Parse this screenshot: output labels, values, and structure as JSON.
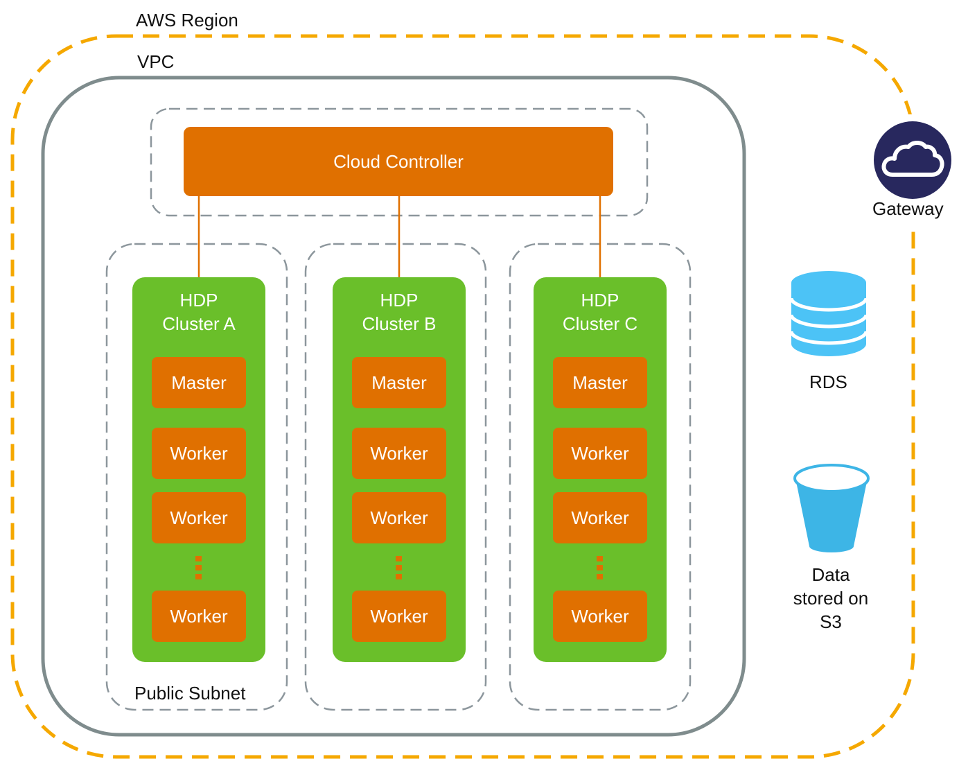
{
  "region": {
    "label": "AWS Region",
    "border_color": "#f5a800"
  },
  "vpc": {
    "label": "VPC",
    "border_color": "#7f8c8d"
  },
  "controller": {
    "label": "Cloud Controller",
    "color": "#e07000"
  },
  "subnet": {
    "label": "Public Subnet"
  },
  "clusters": [
    {
      "title_line1": "HDP",
      "title_line2": "Cluster A",
      "nodes": [
        "Master",
        "Worker",
        "Worker",
        "Worker"
      ]
    },
    {
      "title_line1": "HDP",
      "title_line2": "Cluster B",
      "nodes": [
        "Master",
        "Worker",
        "Worker",
        "Worker"
      ]
    },
    {
      "title_line1": "HDP",
      "title_line2": "Cluster C",
      "nodes": [
        "Master",
        "Worker",
        "Worker",
        "Worker"
      ]
    }
  ],
  "services": {
    "gateway": {
      "label": "Gateway",
      "icon": "cloud-icon",
      "color": "#28285e"
    },
    "rds": {
      "label": "RDS",
      "icon": "database-icon",
      "color": "#4cc3f6"
    },
    "s3": {
      "label_line1": "Data",
      "label_line2": "stored on",
      "label_line3": "S3",
      "icon": "bucket-icon",
      "color": "#3db5e6"
    }
  },
  "colors": {
    "cluster_green": "#6abf2a",
    "node_orange": "#e07000"
  }
}
